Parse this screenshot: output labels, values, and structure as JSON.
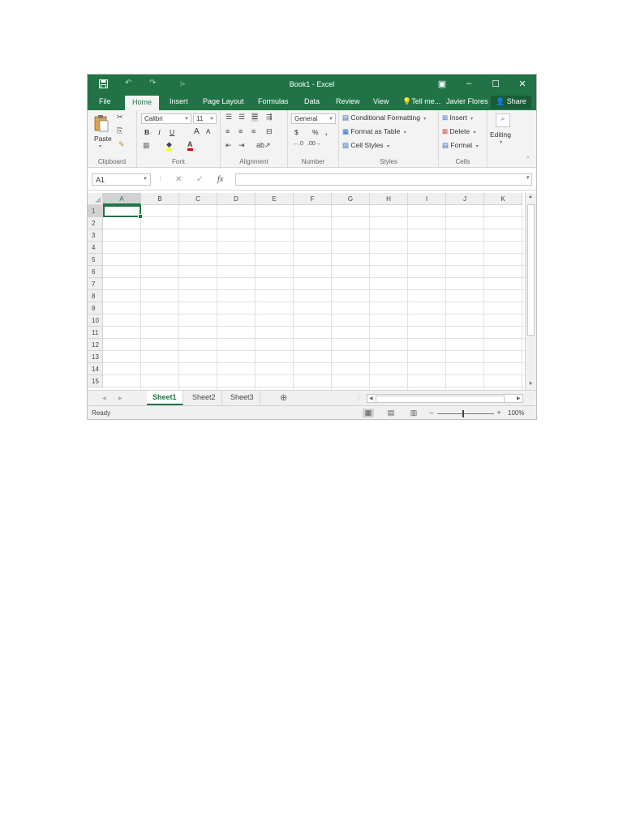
{
  "window": {
    "title": "Book1 - Excel",
    "accent": "#217346",
    "quick_access": {
      "undo": "↶",
      "redo": "↷",
      "customize": "⩥"
    },
    "controls": {
      "ribbon_display": "▣",
      "minimize": "–",
      "maximize": "☐",
      "close": "✕"
    }
  },
  "tabs": [
    "File",
    "Home",
    "Insert",
    "Page Layout",
    "Formulas",
    "Data",
    "Review",
    "View"
  ],
  "tell_me": "Tell me...",
  "user": "Javier Flores",
  "share": "Share",
  "ribbon": {
    "clipboard": {
      "paste": "Paste",
      "label": "Clipboard"
    },
    "font": {
      "name": "Calibri",
      "size": "11",
      "bold": "B",
      "italic": "I",
      "underline": "U",
      "grow": "A",
      "shrink": "A",
      "label": "Font"
    },
    "alignment": {
      "label": "Alignment"
    },
    "number": {
      "format": "General",
      "currency": "$",
      "percent": "%",
      "comma": ",",
      "label": "Number"
    },
    "styles": {
      "conditional": "Conditional Formatting",
      "format_table": "Format as Table",
      "cell_styles": "Cell Styles",
      "label": "Styles"
    },
    "cells": {
      "insert": "Insert",
      "delete": "Delete",
      "format": "Format",
      "label": "Cells"
    },
    "editing": {
      "label": "Editing"
    }
  },
  "formula_bar": {
    "name_box": "A1",
    "cancel": "✕",
    "enter": "✓",
    "fx": "fx",
    "value": ""
  },
  "grid": {
    "columns": [
      "A",
      "B",
      "C",
      "D",
      "E",
      "F",
      "G",
      "H",
      "I",
      "J",
      "K"
    ],
    "rows": [
      "1",
      "2",
      "3",
      "4",
      "5",
      "6",
      "7",
      "8",
      "9",
      "10",
      "11",
      "12",
      "13",
      "14",
      "15"
    ],
    "selected_cell": "A1"
  },
  "sheets": [
    "Sheet1",
    "Sheet2",
    "Sheet3"
  ],
  "active_sheet": "Sheet1",
  "status": {
    "ready": "Ready",
    "zoom": "100%"
  }
}
